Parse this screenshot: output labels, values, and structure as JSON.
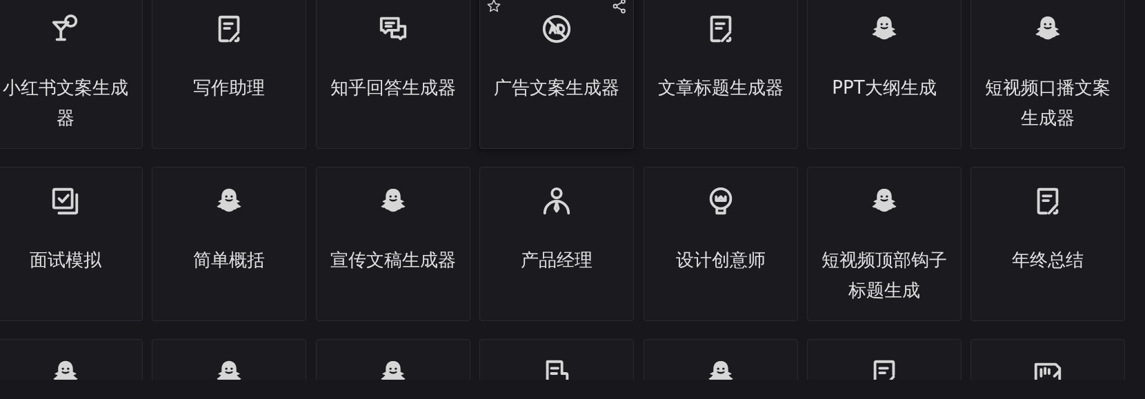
{
  "cards": [
    {
      "kind": "cocktail",
      "title": "小红书文案生成器",
      "hovered": false
    },
    {
      "kind": "edit",
      "title": "写作助理",
      "hovered": false
    },
    {
      "kind": "chat",
      "title": "知乎回答生成器",
      "hovered": false
    },
    {
      "kind": "ad",
      "title": "广告文案生成器",
      "hovered": true
    },
    {
      "kind": "edit",
      "title": "文章标题生成器",
      "hovered": false
    },
    {
      "kind": "ghost",
      "title": "PPT大纲生成",
      "hovered": false
    },
    {
      "kind": "ghost",
      "title": "短视频口播文案生成器",
      "hovered": false
    },
    {
      "kind": "checklist",
      "title": "面试模拟",
      "hovered": false
    },
    {
      "kind": "ghost",
      "title": "简单概括",
      "hovered": false
    },
    {
      "kind": "ghost",
      "title": "宣传文稿生成器",
      "hovered": false
    },
    {
      "kind": "person",
      "title": "产品经理",
      "hovered": false
    },
    {
      "kind": "lightbulb",
      "title": "设计创意师",
      "hovered": false
    },
    {
      "kind": "ghost",
      "title": "短视频顶部钩子标题生成",
      "hovered": false
    },
    {
      "kind": "edit",
      "title": "年终总结",
      "hovered": false
    },
    {
      "kind": "ghost",
      "hovered": false
    },
    {
      "kind": "ghost",
      "hovered": false
    },
    {
      "kind": "ghost",
      "hovered": false
    },
    {
      "kind": "document",
      "hovered": false
    },
    {
      "kind": "ghost",
      "hovered": false
    },
    {
      "kind": "edit",
      "hovered": false
    },
    {
      "kind": "waveform",
      "hovered": false
    }
  ]
}
